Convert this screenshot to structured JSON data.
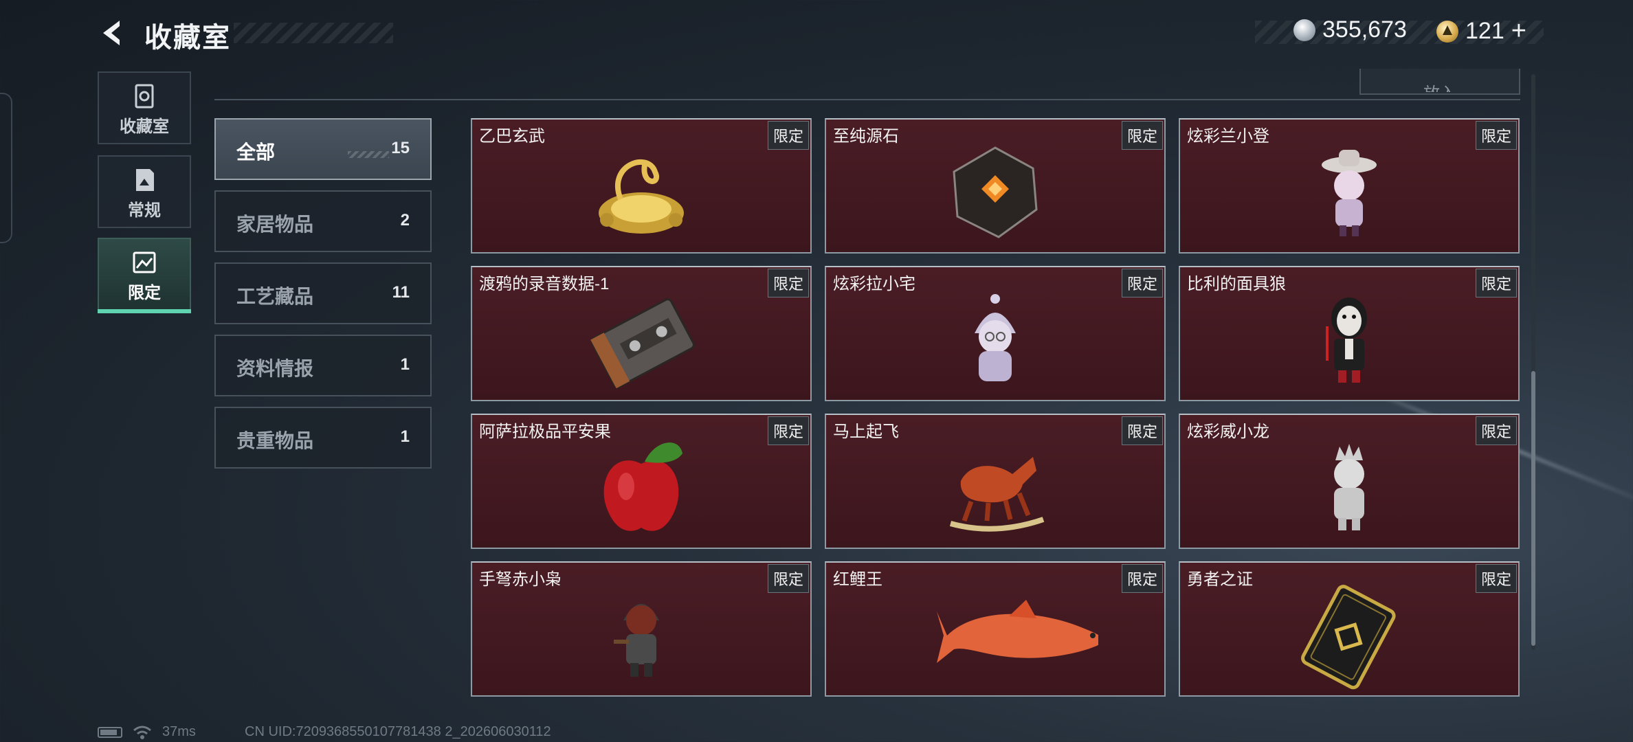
{
  "header": {
    "title": "收藏室",
    "silver": "355,673",
    "gold": "121",
    "add_label": "+"
  },
  "top_button_label": "放入",
  "nav": [
    {
      "id": "collection",
      "label": "收藏室",
      "active": false
    },
    {
      "id": "regular",
      "label": "常规",
      "active": false
    },
    {
      "id": "limited",
      "label": "限定",
      "active": true
    }
  ],
  "categories": [
    {
      "label": "全部",
      "count": "15",
      "active": true
    },
    {
      "label": "家居物品",
      "count": "2"
    },
    {
      "label": "工艺藏品",
      "count": "11"
    },
    {
      "label": "资料情报",
      "count": "1"
    },
    {
      "label": "贵重物品",
      "count": "1"
    }
  ],
  "items": [
    {
      "name": "乙巴玄武",
      "tag": "限定",
      "icon": "gold-dragon-turtle-icon"
    },
    {
      "name": "至纯源石",
      "tag": "限定",
      "icon": "source-stone-icon"
    },
    {
      "name": "炫彩兰小登",
      "tag": "限定",
      "icon": "figurine-sombrero-icon"
    },
    {
      "name": "渡鸦的录音数据-1",
      "tag": "限定",
      "icon": "cassette-tape-icon"
    },
    {
      "name": "炫彩拉小宅",
      "tag": "限定",
      "icon": "figurine-hooded-icon"
    },
    {
      "name": "比利的面具狼",
      "tag": "限定",
      "icon": "puppet-figure-icon"
    },
    {
      "name": "阿萨拉极品平安果",
      "tag": "限定",
      "icon": "red-apple-icon"
    },
    {
      "name": "马上起飞",
      "tag": "限定",
      "icon": "rocking-horse-icon"
    },
    {
      "name": "炫彩威小龙",
      "tag": "限定",
      "icon": "figurine-crown-icon"
    },
    {
      "name": "手弩赤小枭",
      "tag": "限定",
      "icon": "hooded-soldier-icon"
    },
    {
      "name": "红鲤王",
      "tag": "限定",
      "icon": "red-carp-icon"
    },
    {
      "name": "勇者之证",
      "tag": "限定",
      "icon": "gold-card-icon"
    }
  ],
  "footer": {
    "ping": "37ms",
    "uid": "CN UID:7209368550107781438 2_202606030112"
  },
  "colors": {
    "card_bg": "#45181f",
    "accent": "#5fd3b0",
    "tag_bg": "#2a2d31"
  }
}
